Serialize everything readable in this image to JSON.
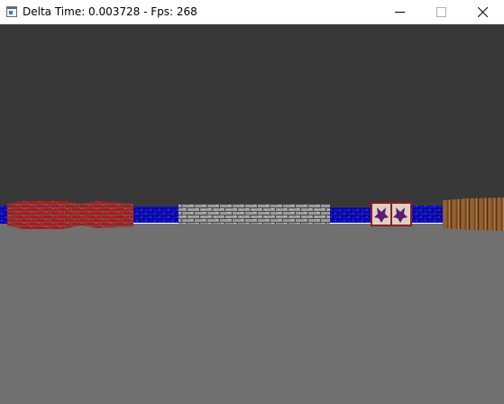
{
  "window": {
    "title": "Delta Time: 0.003728 - Fps: 268"
  },
  "colors": {
    "ceiling": "#383838",
    "floor": "#707070",
    "blue_stone": "#1010c8",
    "red_brick": "#b01818",
    "grey_stone": "#9a9a9a",
    "wood": "#8a5a30",
    "eagle_banner": "#e0d0c0"
  },
  "icons": {
    "app": "app-window-icon",
    "minimize": "minimize-icon",
    "maximize": "maximize-icon",
    "close": "close-icon"
  }
}
